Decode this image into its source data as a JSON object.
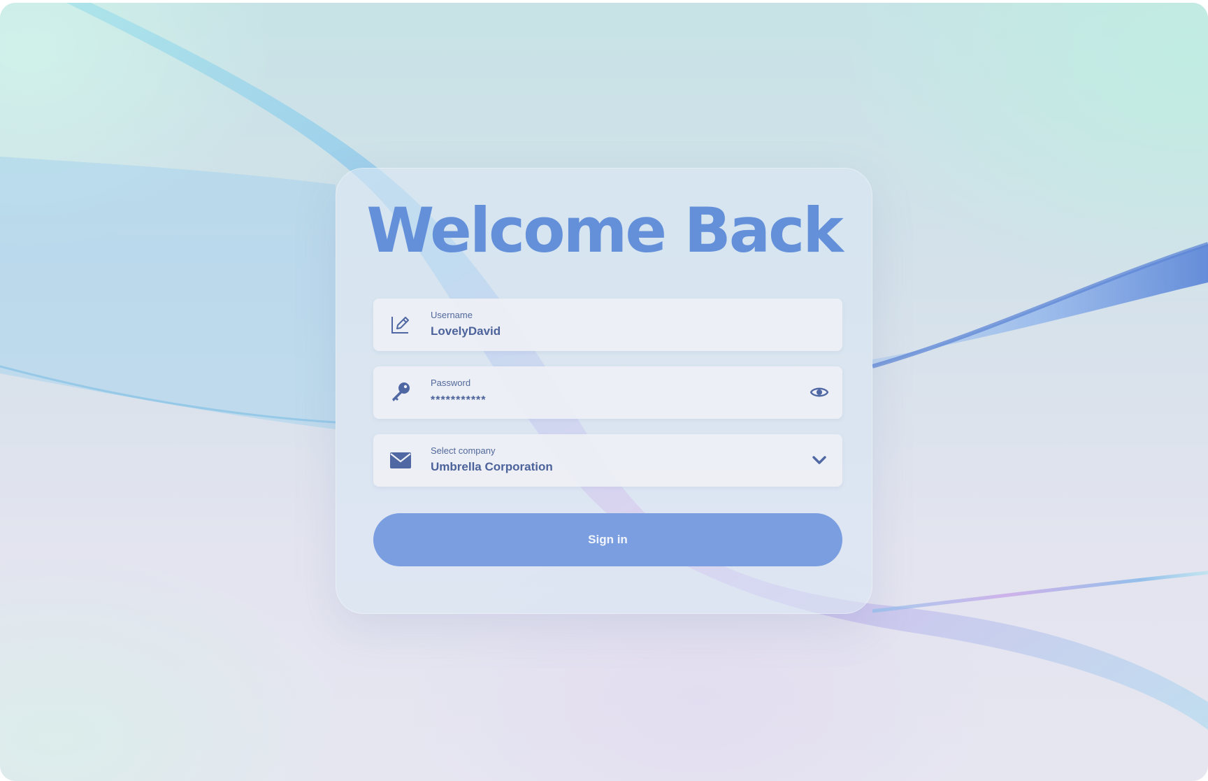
{
  "page": {
    "title": "Welcome Back"
  },
  "form": {
    "username": {
      "label": "Username",
      "value": "LovelyDavid"
    },
    "password": {
      "label": "Password",
      "value": "***********"
    },
    "company": {
      "label": "Select company",
      "value": "Umbrella Corporation"
    },
    "submit_label": "Sign in"
  },
  "icons": {
    "username": "edit-icon",
    "password": "key-icon",
    "password_toggle": "eye-icon",
    "company": "mail-icon",
    "company_dropdown": "chevron-down-icon"
  },
  "colors": {
    "accent": "#7b9ee0",
    "title": "#6490da",
    "field_text": "#4c629b"
  }
}
